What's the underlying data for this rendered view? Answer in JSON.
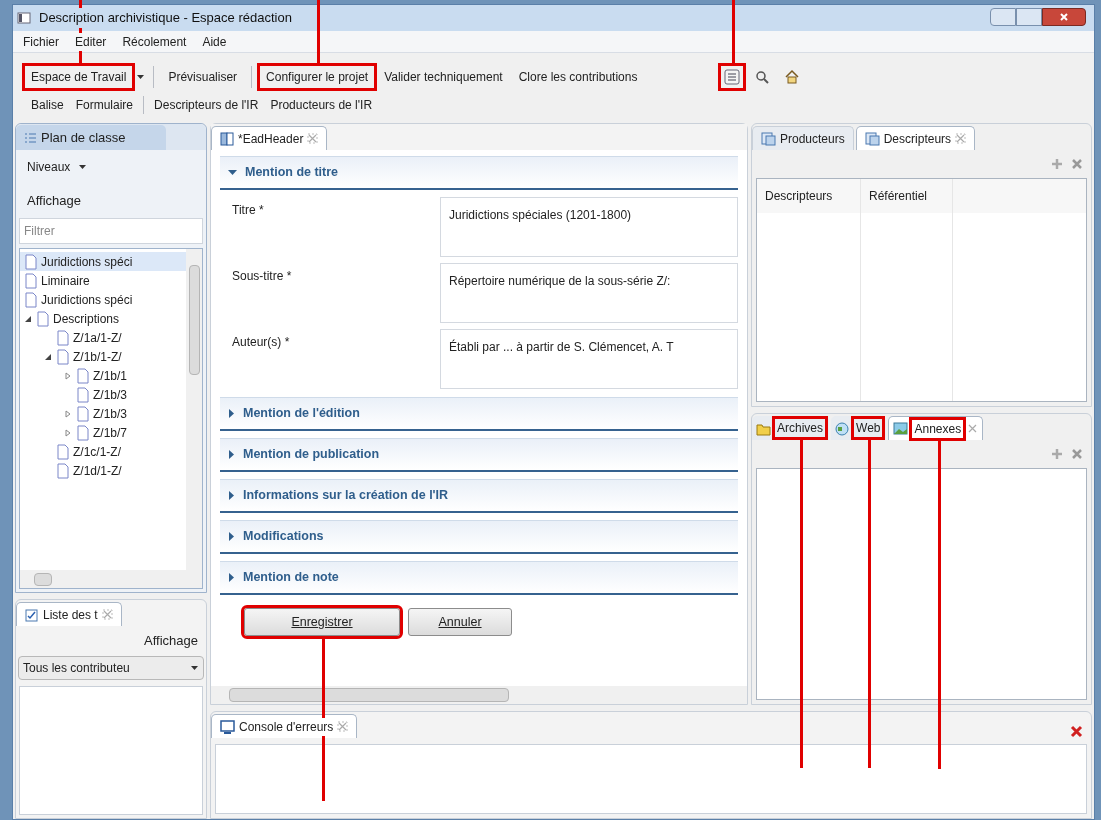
{
  "window": {
    "title": "Description archivistique - Espace rédaction"
  },
  "menu": [
    "Fichier",
    "Editer",
    "Récolement",
    "Aide"
  ],
  "toolbar": [
    {
      "label": "Espace de Travail",
      "kind": "dropdown",
      "highlighted": true
    },
    {
      "label": "Prévisualiser",
      "kind": "button"
    },
    {
      "label": "Configurer le projet",
      "kind": "button",
      "highlighted": true
    },
    {
      "label": "Valider techniquement",
      "kind": "button"
    },
    {
      "label": "Clore les contributions",
      "kind": "button"
    }
  ],
  "toolbar_icons": [
    {
      "kind": "list",
      "highlighted": true
    },
    {
      "kind": "search"
    },
    {
      "kind": "home"
    }
  ],
  "toolbar2": [
    "Balise",
    "Formulaire",
    "Descripteurs de l'IR",
    "Producteurs de l'IR"
  ],
  "plan": {
    "tab": "Plan de classe",
    "levels": "Niveaux",
    "display": "Affichage",
    "filter_placeholder": "Filtrer",
    "tree": [
      {
        "label": "Juridictions spéci",
        "selected": true
      },
      {
        "label": "Liminaire",
        "selected": false
      },
      {
        "label": "Juridictions spéci",
        "selected": false
      },
      {
        "label": "Descriptions",
        "selected": false,
        "expanded": true,
        "children": [
          {
            "label": "Z/1a/1-Z/",
            "selected": false
          },
          {
            "label": "Z/1b/1-Z/",
            "selected": false,
            "expanded": true,
            "children": [
              {
                "label": "Z/1b/1",
                "selected": false,
                "expanded": false
              },
              {
                "label": "Z/1b/3",
                "selected": false
              },
              {
                "label": "Z/1b/3",
                "selected": false,
                "expanded": false
              },
              {
                "label": "Z/1b/7",
                "selected": false,
                "expanded": false
              }
            ]
          },
          {
            "label": "Z/1c/1-Z/",
            "selected": false
          },
          {
            "label": "Z/1d/1-Z/",
            "selected": false
          }
        ]
      }
    ]
  },
  "tasks": {
    "tab": "Liste des t",
    "display": "Affichage",
    "select": "Tous les contributeu"
  },
  "editor": {
    "tab": "*EadHeader",
    "sections": [
      {
        "title": "Mention de titre",
        "expanded": true,
        "fields": [
          {
            "label": "Titre *",
            "value": "Juridictions spéciales (1201-1800)"
          },
          {
            "label": "Sous-titre *",
            "value": "Répertoire numérique de la sous-série Z/:"
          },
          {
            "label": "Auteur(s) *",
            "value": "Établi par ... à partir de S. Clémencet, A. T"
          }
        ]
      },
      {
        "title": "Mention de l'édition",
        "expanded": false
      },
      {
        "title": "Mention de publication",
        "expanded": false
      },
      {
        "title": "Informations sur la création de l'IR",
        "expanded": false
      },
      {
        "title": "Modifications",
        "expanded": false
      },
      {
        "title": "Mention de note",
        "expanded": false
      }
    ],
    "buttons": [
      {
        "label": "Enregistrer",
        "highlighted": true
      },
      {
        "label": "Annuler"
      }
    ]
  },
  "right_top": {
    "tabs": [
      {
        "label": "Producteurs",
        "selected": false
      },
      {
        "label": "Descripteurs",
        "selected": true
      }
    ],
    "columns": [
      "Descripteurs",
      "Référentiel"
    ]
  },
  "right_bottom": {
    "tabs": [
      {
        "label": "Archives",
        "selected": false,
        "highlighted": true
      },
      {
        "label": "Web",
        "selected": false,
        "highlighted": true
      },
      {
        "label": "Annexes",
        "selected": true,
        "highlighted": true
      }
    ]
  },
  "console": {
    "tab": "Console d'erreurs"
  }
}
